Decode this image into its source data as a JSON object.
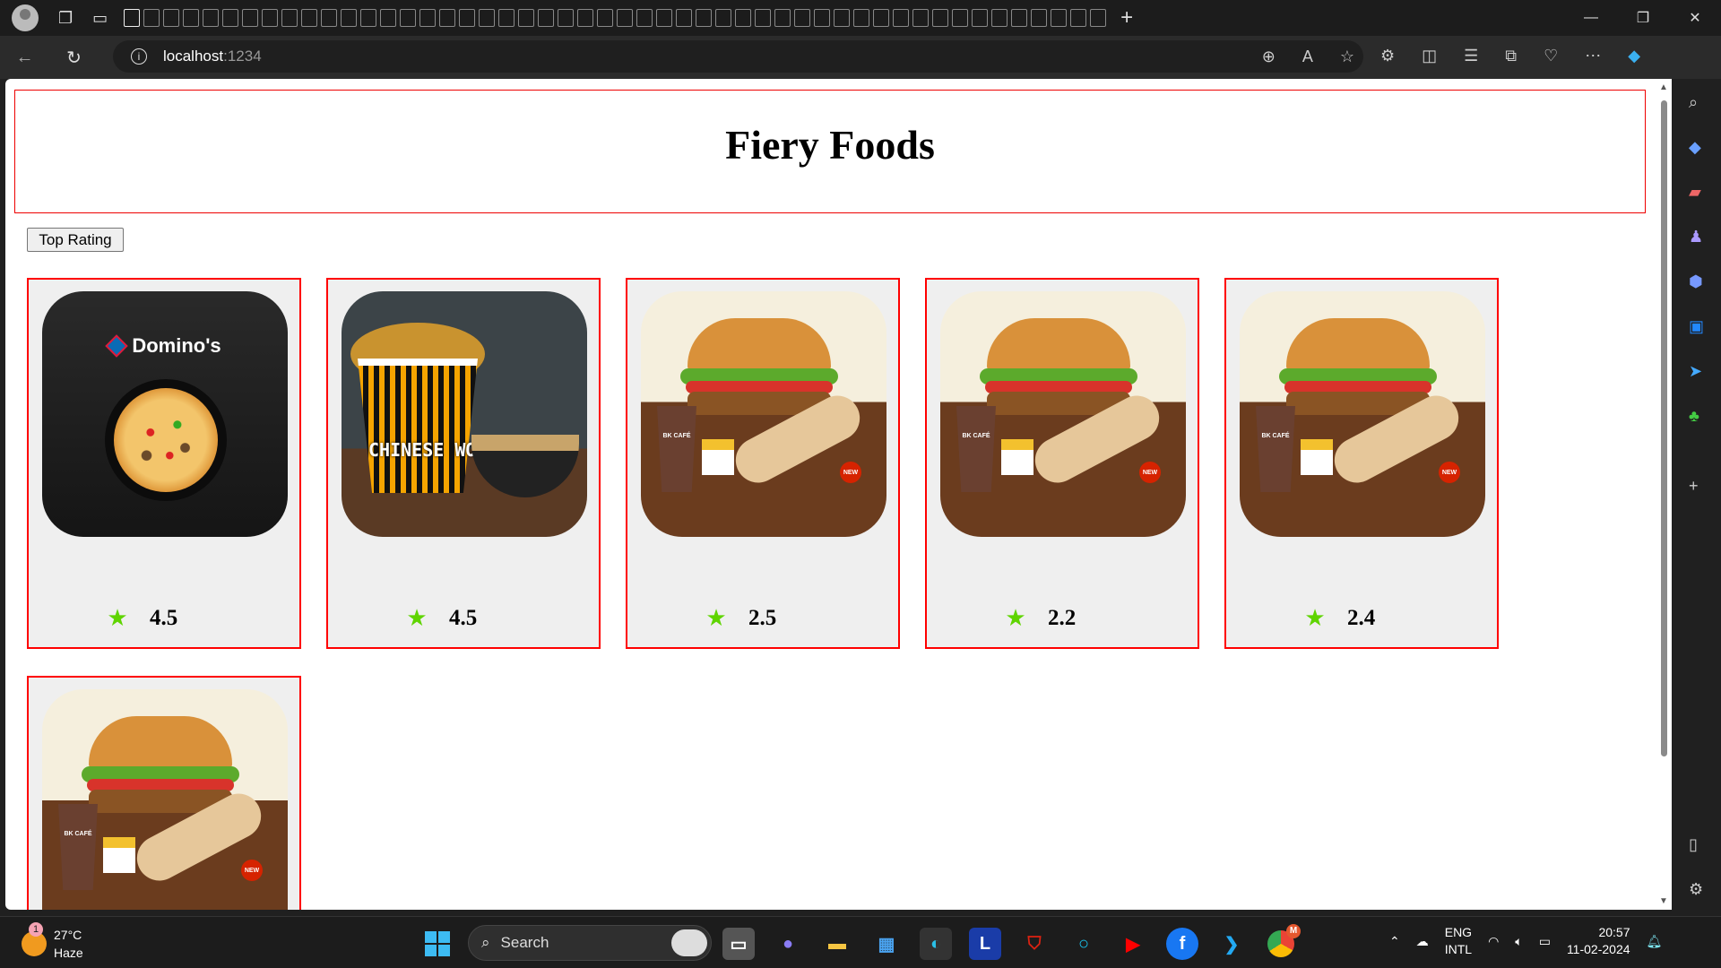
{
  "browser": {
    "url_host": "localhost",
    "url_port": ":1234",
    "tab_count_shown": 50
  },
  "page": {
    "title": "Fiery Foods",
    "top_rating_button": "Top Rating",
    "colors": {
      "card_border": "#ff0000",
      "header_border": "#e00000",
      "star": "#5fd400",
      "card_bg": "#efefef"
    },
    "restaurants": [
      {
        "image": "dominos",
        "logo_text": "Domino's",
        "rating": "4.5"
      },
      {
        "image": "chinese-wok",
        "logo_text": "CHINESE WOK",
        "rating": "4.5"
      },
      {
        "image": "burger-king",
        "logo_text": "BK CAFÉ NEW",
        "rating": "2.5"
      },
      {
        "image": "burger-king",
        "logo_text": "BK CAFÉ NEW",
        "rating": "2.2"
      },
      {
        "image": "burger-king",
        "logo_text": "BK CAFÉ NEW",
        "rating": "2.4"
      },
      {
        "image": "burger-king",
        "logo_text": "BK CAFÉ NEW",
        "rating": null
      }
    ]
  },
  "taskbar": {
    "weather_badge": "1",
    "temperature": "27°C",
    "condition": "Haze",
    "search_label": "Search",
    "language_top": "ENG",
    "language_bottom": "INTL",
    "time": "20:57",
    "date": "11-02-2024",
    "chrome_badge": "M"
  }
}
